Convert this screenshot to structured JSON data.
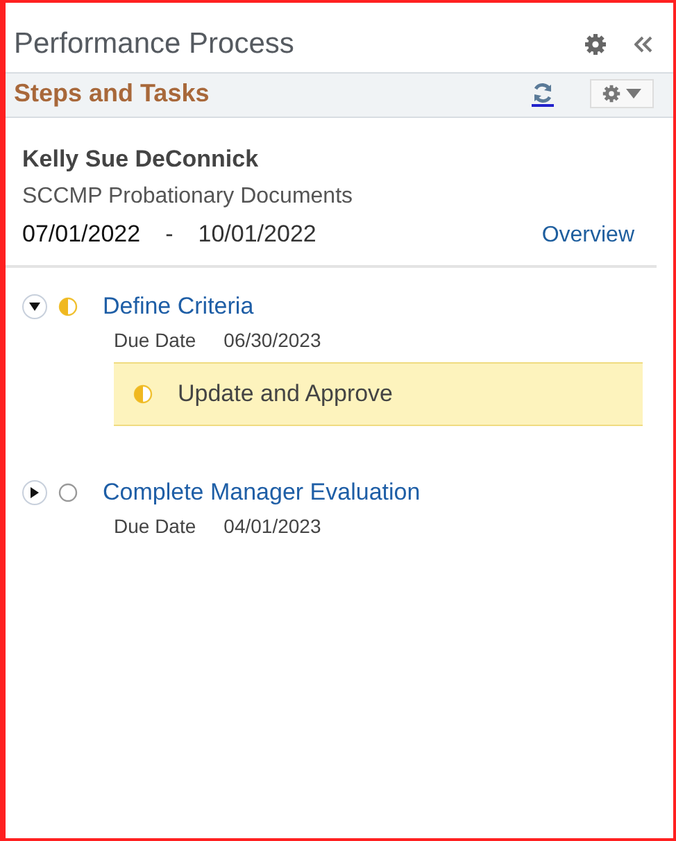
{
  "panel": {
    "title": "Performance Process"
  },
  "section": {
    "title": "Steps and Tasks"
  },
  "employee": {
    "name": "Kelly Sue DeConnick",
    "document": "SCCMP Probationary Documents",
    "start_date": "07/01/2022",
    "separator": "-",
    "end_date": "10/01/2022",
    "link": "Overview"
  },
  "steps": [
    {
      "title": "Define Criteria",
      "kind": "partial",
      "expanded": true,
      "due_label": "Due Date",
      "due_date": "06/30/2023",
      "tasks": [
        {
          "title": "Update and Approve",
          "kind": "partial"
        }
      ]
    },
    {
      "title": "Complete Manager Evaluation",
      "kind": "empty",
      "expanded": false,
      "due_label": "Due Date",
      "due_date": "04/01/2023"
    }
  ]
}
